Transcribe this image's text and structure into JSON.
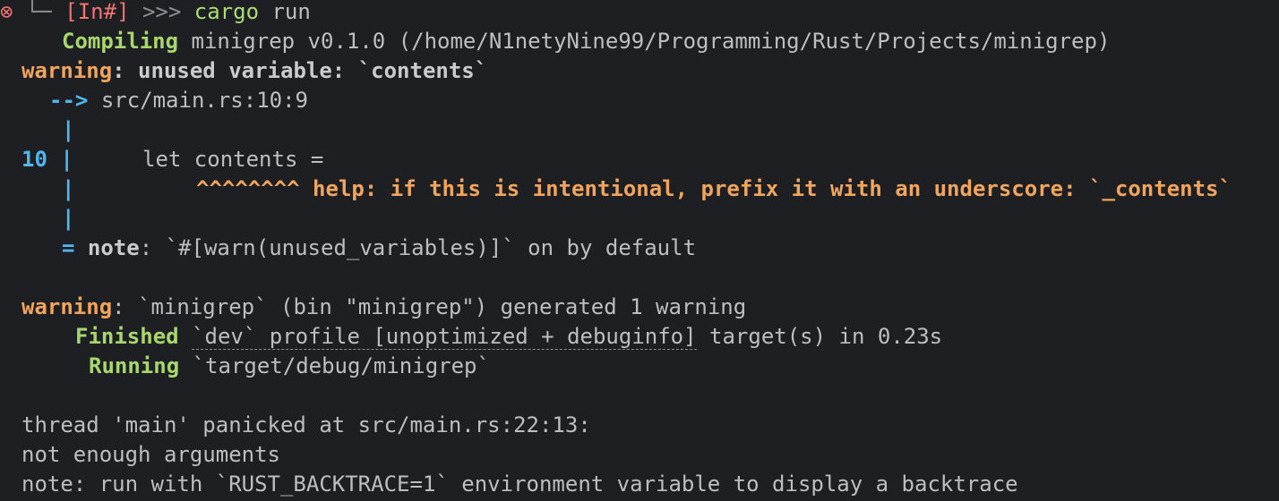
{
  "prompt": {
    "error_icon": "⊗",
    "tree_glyph": "└─",
    "tag": "[In#]",
    "arrows": ">>>",
    "cmd_name": "cargo",
    "cmd_arg": "run"
  },
  "compile": {
    "label": "Compiling",
    "text": "minigrep v0.1.0 (/home/N1netyNine99/Programming/Rust/Projects/minigrep)"
  },
  "warning1": {
    "label": "warning",
    "message": ": unused variable: `contents`",
    "arrow": "-->",
    "location": "src/main.rs:10:9",
    "pipe": "|",
    "line_number": "10",
    "code": "let contents =",
    "carets": "^^^^^^^^",
    "help": "help: if this is intentional, prefix it with an underscore: `_contents`",
    "note_eq": "=",
    "note_label": "note",
    "note_text": ": `#[warn(unused_variables)]` on by default"
  },
  "warning2": {
    "label": "warning",
    "text": ": `minigrep` (bin \"minigrep\") generated 1 warning"
  },
  "finished": {
    "label": "Finished",
    "profile": "`dev` profile [unoptimized + debuginfo]",
    "rest": " target(s) in 0.23s"
  },
  "running": {
    "label": "Running",
    "text": "`target/debug/minigrep`"
  },
  "panic": {
    "line1": "thread 'main' panicked at src/main.rs:22:13:",
    "line2": "not enough arguments",
    "line3": "note: run with `RUST_BACKTRACE=1` environment variable to display a backtrace"
  },
  "colors": {
    "background": "#1e1f22",
    "foreground": "#bcbec4",
    "green": "#a8d66e",
    "orange": "#f0a45d",
    "blue": "#4fb6f0",
    "red": "#f0736e"
  }
}
